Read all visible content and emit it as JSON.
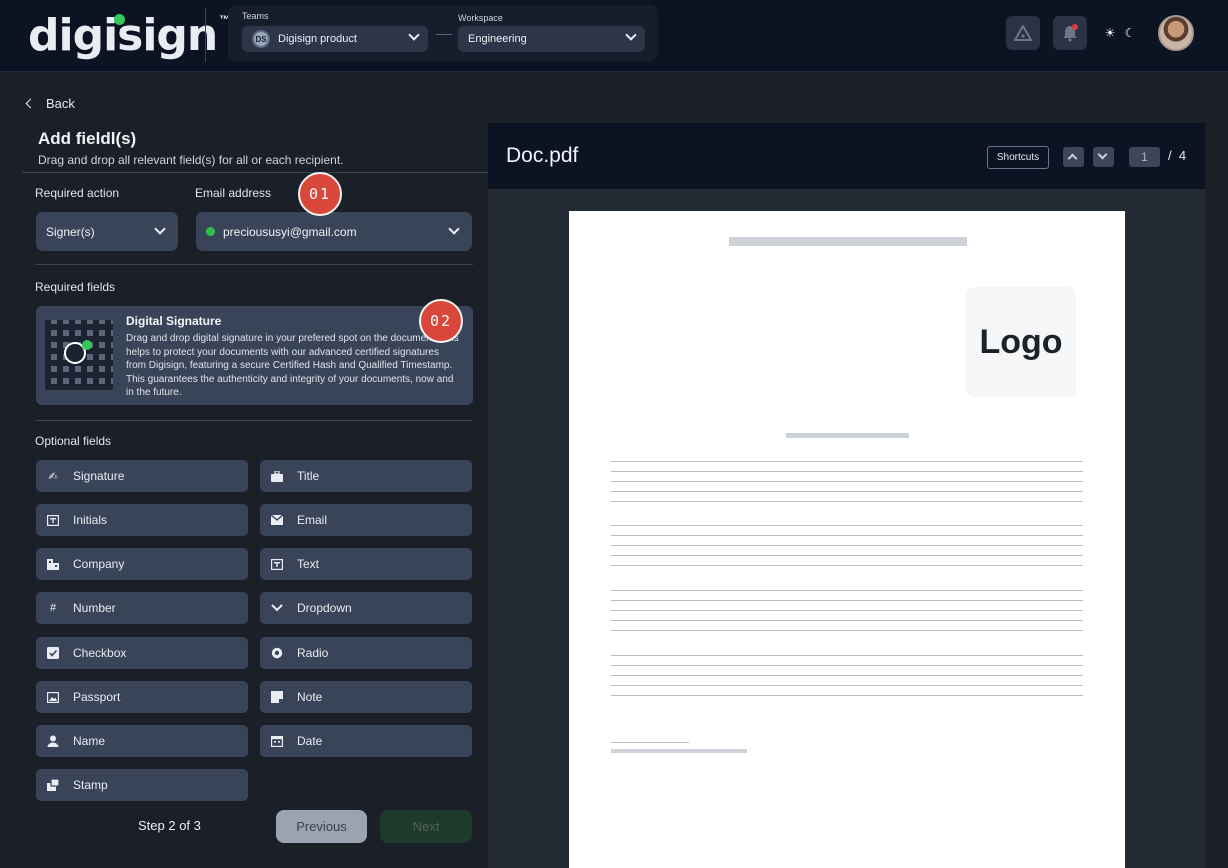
{
  "header": {
    "logo_text": "digisign",
    "logo_tm": "™",
    "teams_label": "Teams",
    "team_initials": "DS",
    "team_value": "Digisign product",
    "workspace_label": "Workspace",
    "workspace_value": "Engineering"
  },
  "back_label": "Back",
  "panel": {
    "title": "Add fieldl(s)",
    "subtitle": "Drag and drop all relevant field(s) for all or each recipient.",
    "required_action_label": "Required action",
    "required_action_value": "Signer(s)",
    "email_label": "Email address",
    "email_value": "precioususyi@gmail.com",
    "required_fields_label": "Required fields",
    "digital_signature": {
      "title": "Digital Signature",
      "description": "Drag and drop digital signature in your prefered spot on the document. This helps to protect your documents with our advanced certified signatures from Digisign, featuring a secure Certified Hash and Qualified Timestamp. This guarantees the authenticity and integrity of your documents, now and in the future."
    },
    "optional_fields_label": "Optional fields",
    "optional_fields": [
      {
        "label": "Signature",
        "icon": "signature-icon"
      },
      {
        "label": "Title",
        "icon": "briefcase-icon"
      },
      {
        "label": "Initials",
        "icon": "initials-icon"
      },
      {
        "label": "Email",
        "icon": "mail-icon"
      },
      {
        "label": "Company",
        "icon": "building-icon"
      },
      {
        "label": "Text",
        "icon": "text-icon"
      },
      {
        "label": "Number",
        "icon": "hash-icon"
      },
      {
        "label": "Dropdown",
        "icon": "chevron-down-icon"
      },
      {
        "label": "Checkbox",
        "icon": "checkbox-icon"
      },
      {
        "label": "Radio",
        "icon": "radio-icon"
      },
      {
        "label": "Passport",
        "icon": "image-icon"
      },
      {
        "label": "Note",
        "icon": "note-icon"
      },
      {
        "label": "Name",
        "icon": "person-icon"
      },
      {
        "label": "Date",
        "icon": "calendar-icon"
      },
      {
        "label": "Stamp",
        "icon": "stamp-icon"
      }
    ],
    "step_text": "Step 2 of 3",
    "previous_label": "Previous",
    "next_label": "Next"
  },
  "badges": {
    "one": "01",
    "two": "02"
  },
  "document": {
    "name": "Doc.pdf",
    "shortcuts_label": "Shortcuts",
    "current_page": "1",
    "page_separator": "/",
    "total_pages": "4",
    "logo_placeholder": "Logo"
  }
}
